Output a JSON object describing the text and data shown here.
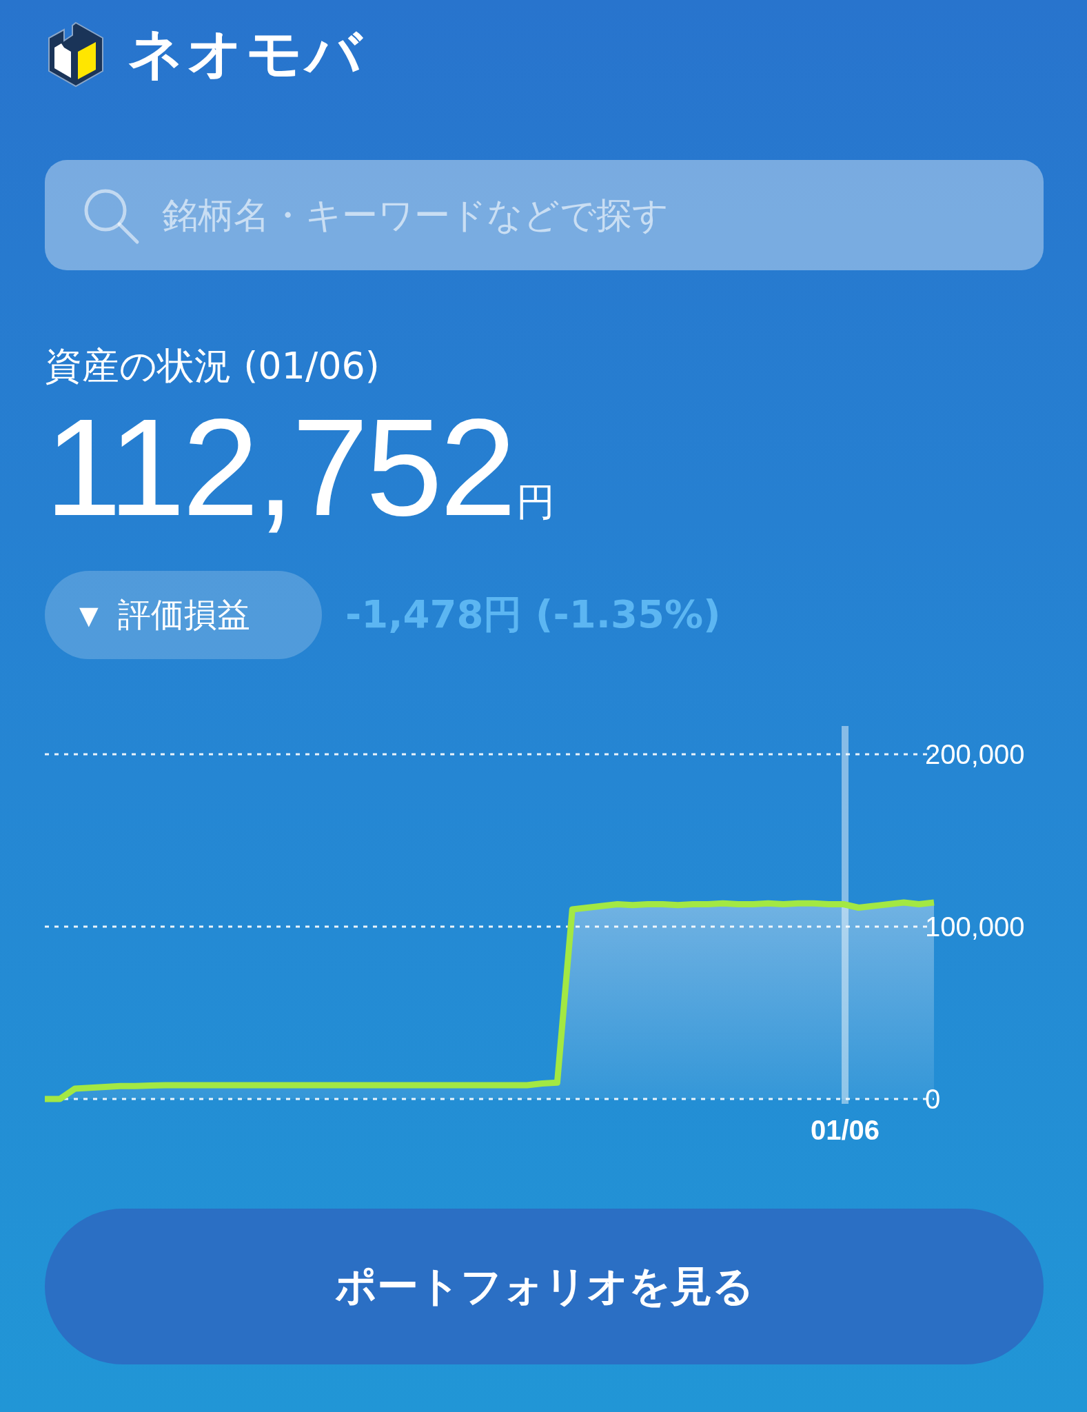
{
  "header": {
    "logo_text": "ネオモバ"
  },
  "search": {
    "placeholder": "銘柄名・キーワードなどで探す"
  },
  "assets": {
    "title": "資産の状況 (01/06)",
    "amount": "112,752",
    "unit": "円",
    "pl_toggle": "▼",
    "pl_label": "評価損益",
    "pl_value": "-1,478円 (-1.35%)"
  },
  "chart": {
    "chart_data": {
      "type": "area",
      "ylim": [
        0,
        200000
      ],
      "yticks": [
        {
          "value": 0,
          "label": "0"
        },
        {
          "value": 100000,
          "label": "100,000"
        },
        {
          "value": 200000,
          "label": "200,000"
        }
      ],
      "annotations": [
        "01/06"
      ],
      "series": [
        {
          "color": "#a3e843",
          "values": [
            0,
            0,
            6000,
            6500,
            7000,
            7500,
            7500,
            7800,
            8000,
            8000,
            8000,
            8000,
            8000,
            8000,
            8000,
            8000,
            8000,
            8000,
            8000,
            8000,
            8000,
            8000,
            8000,
            8000,
            8000,
            8000,
            8000,
            8000,
            8000,
            8000,
            8000,
            8000,
            8000,
            9000,
            9500,
            110000,
            111000,
            112000,
            113000,
            112500,
            113000,
            113000,
            112500,
            113000,
            113000,
            113500,
            113000,
            113000,
            113500,
            113000,
            113500,
            113500,
            113000,
            113000,
            111000,
            112000,
            113000,
            114000,
            113000,
            114000
          ]
        }
      ]
    }
  },
  "button": {
    "label": "ポートフォリオを見る"
  }
}
